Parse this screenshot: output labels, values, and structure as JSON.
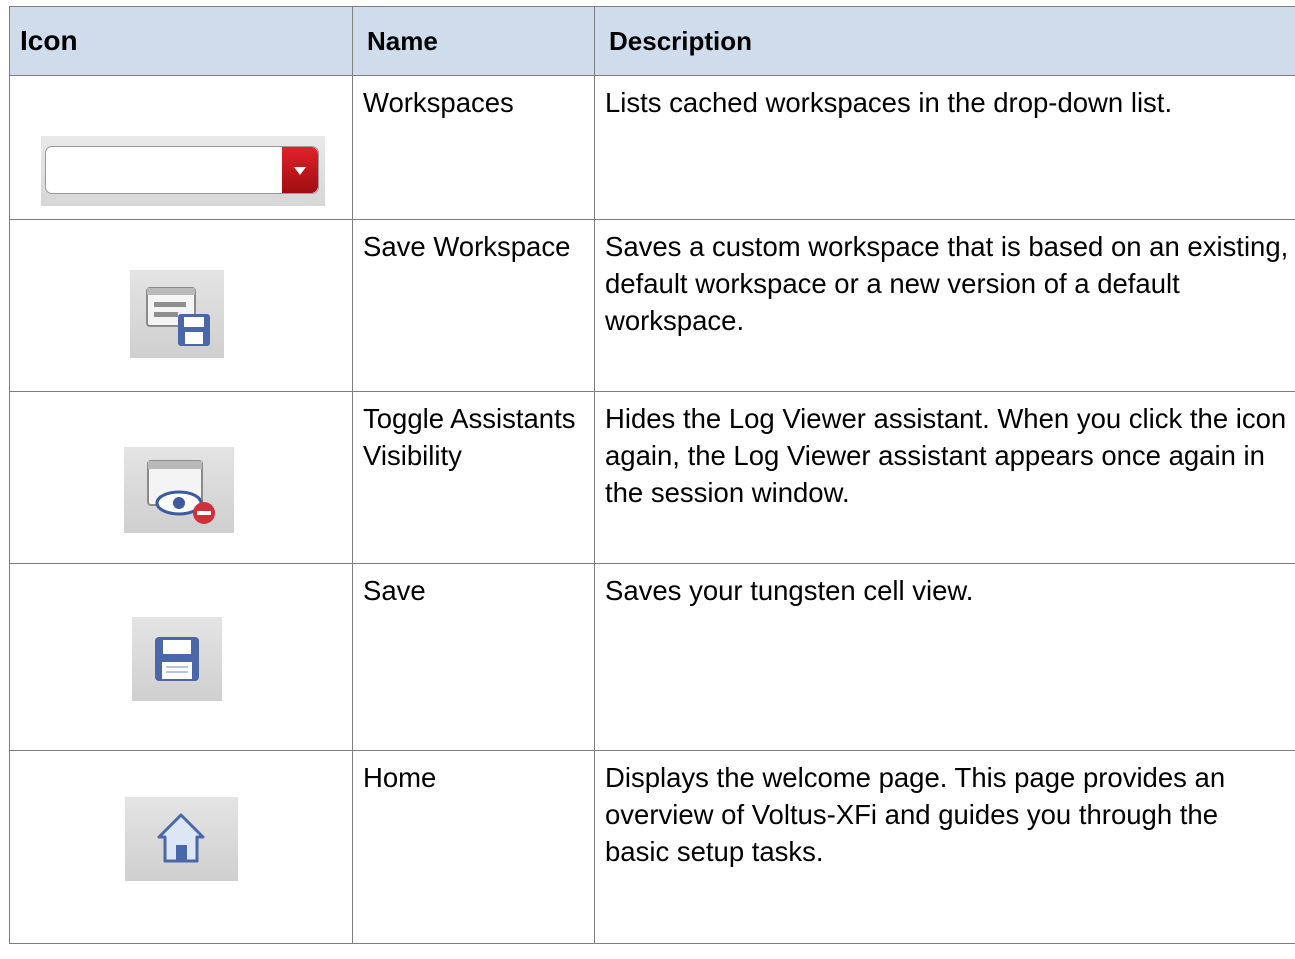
{
  "table": {
    "headers": {
      "icon": "Icon",
      "name": "Name",
      "description": "Description"
    },
    "rows": [
      {
        "icon": "workspaces-dropdown-icon",
        "name": "Workspaces",
        "description": "Lists cached workspaces in the drop-down list."
      },
      {
        "icon": "save-workspace-icon",
        "name": "Save Workspace",
        "description": "Saves a custom workspace that is based on an existing, default workspace or a new version of a default workspace."
      },
      {
        "icon": "toggle-visibility-icon",
        "name": "Toggle Assistants Visibility",
        "description": "Hides the Log Viewer assistant. When you click the icon again, the Log Viewer assistant appears once again in the session window."
      },
      {
        "icon": "floppy-disk-icon",
        "name": "Save",
        "description": "Saves your tungsten cell view."
      },
      {
        "icon": "home-icon",
        "name": "Home",
        "description": "Displays the welcome page. This page provides an overview of Voltus-XFi and guides you through the basic setup tasks."
      }
    ]
  },
  "colors": {
    "header_background": "#cfdcec",
    "border": "#7f7f7f",
    "dropdown_button": "#c8141b",
    "icon_blue": "#4a68a8"
  }
}
